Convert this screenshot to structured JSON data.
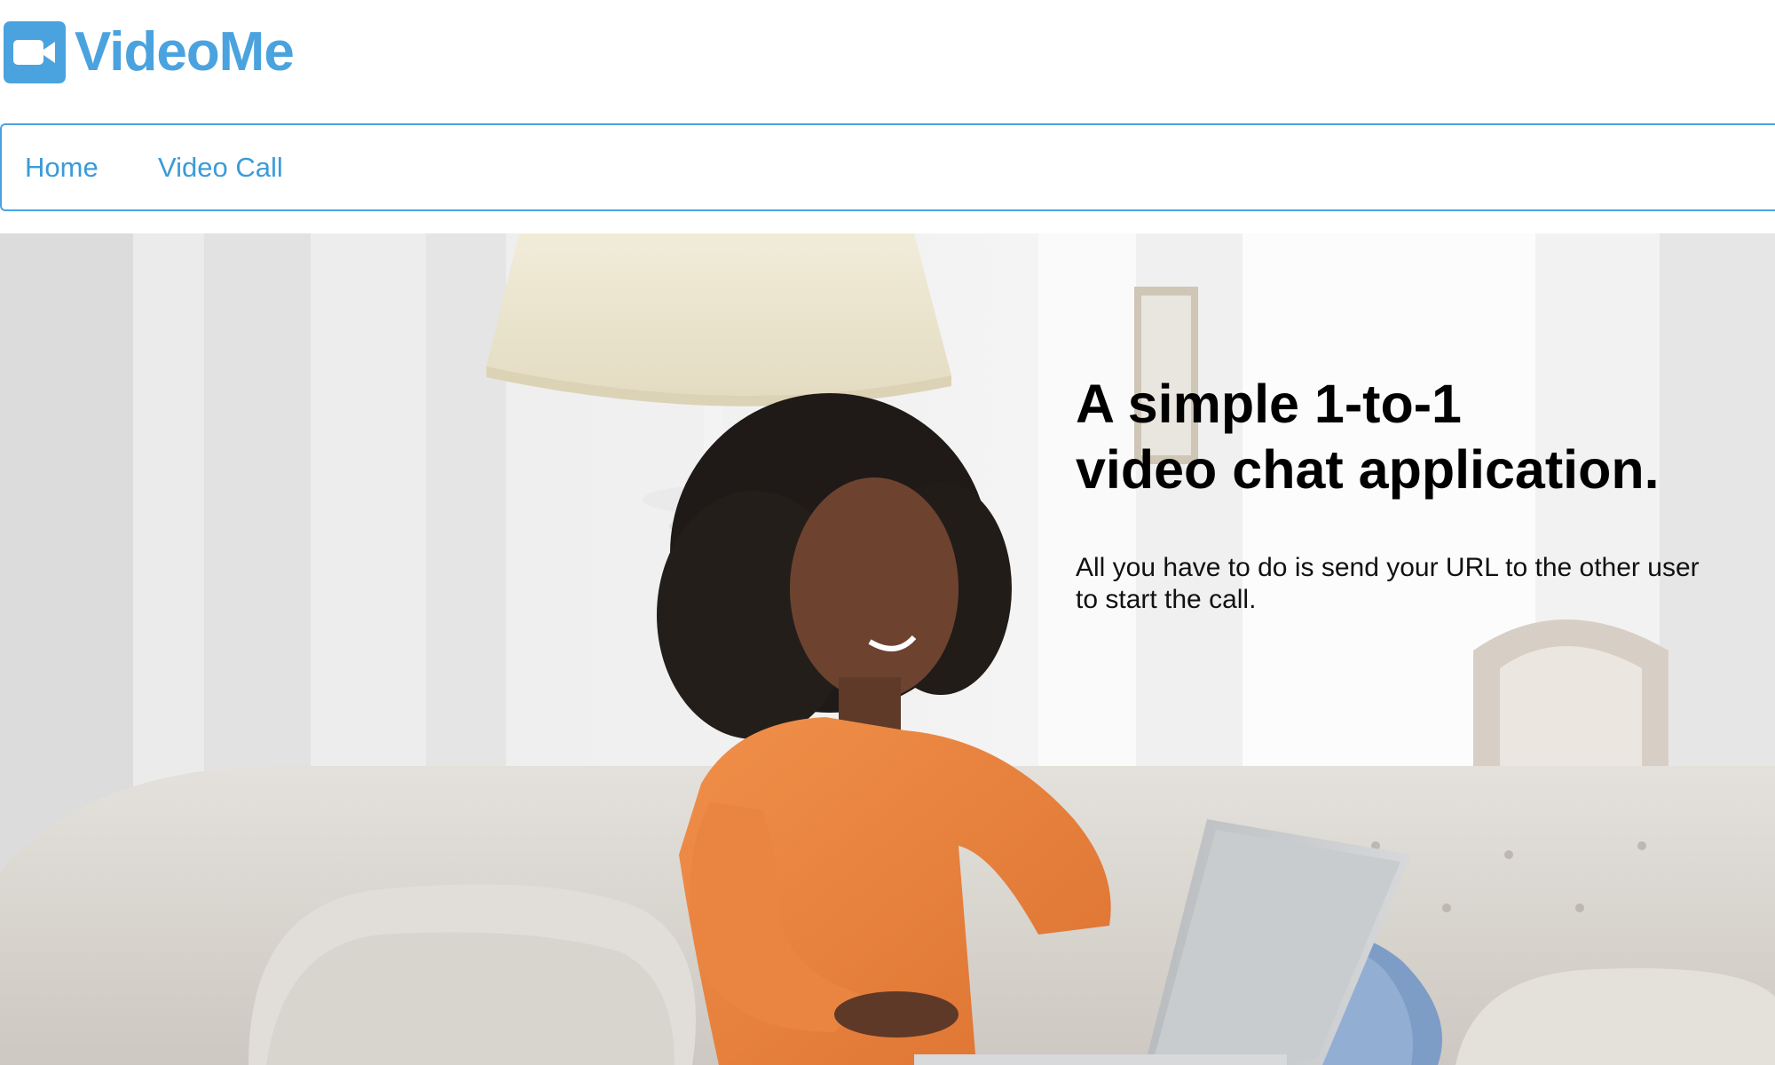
{
  "brand": {
    "name": "VideoMe",
    "icon": "video-camera-icon",
    "color": "#4aa3df"
  },
  "nav": {
    "items": [
      {
        "label": "Home"
      },
      {
        "label": "Video Call"
      }
    ],
    "link_color": "#3b9bd9",
    "border_color": "#4aa3df"
  },
  "hero": {
    "title_line1": "A simple 1-to-1",
    "title_line2": "video chat application.",
    "subtitle": "All you have to do is send your URL to the other user to start the call.",
    "image": "woman-on-sofa-with-laptop-photo"
  }
}
